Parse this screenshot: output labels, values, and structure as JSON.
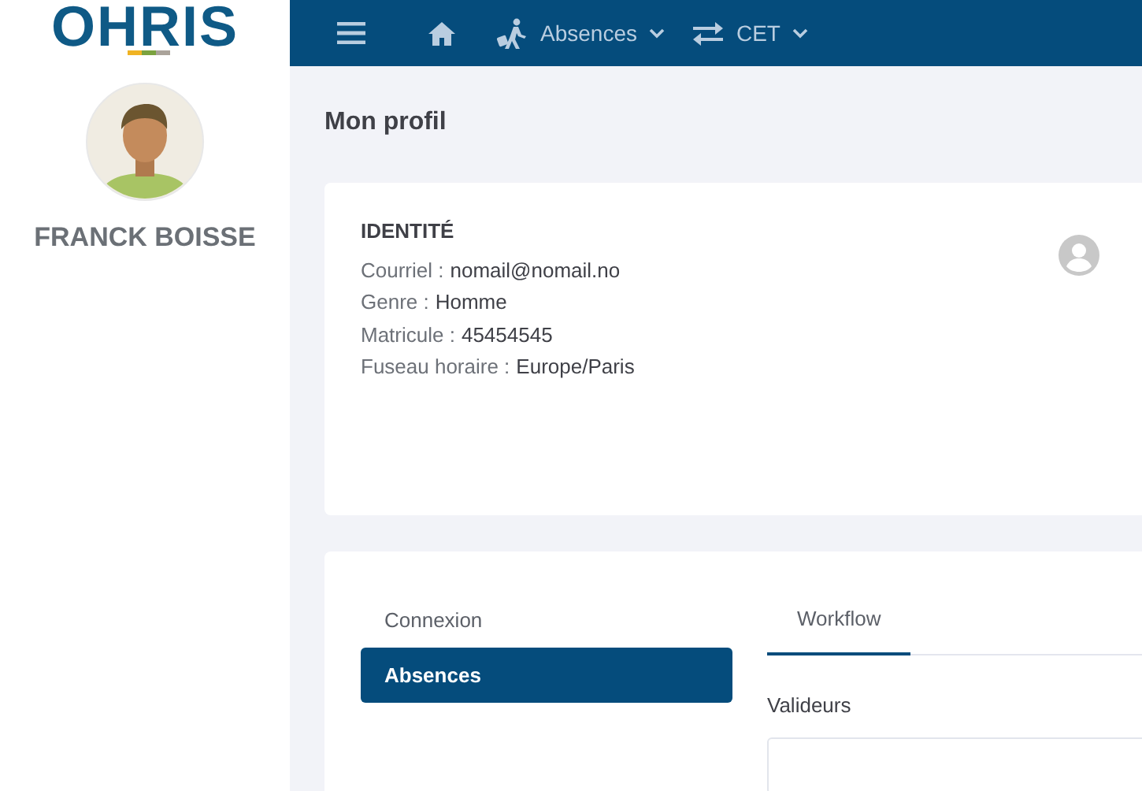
{
  "logo": {
    "text": "OHRIS"
  },
  "user": {
    "name": "FRANCK BOISSE"
  },
  "topbar": {
    "items": [
      {
        "kind": "menu"
      },
      {
        "kind": "home"
      },
      {
        "kind": "dropdown",
        "label": "Absences"
      },
      {
        "kind": "dropdown",
        "label": "CET"
      }
    ]
  },
  "page": {
    "title": "Mon profil"
  },
  "identity": {
    "heading": "IDENTITÉ",
    "fields": [
      {
        "label": "Courriel :",
        "value": "nomail@nomail.no"
      },
      {
        "label": "Genre :",
        "value": "Homme"
      },
      {
        "label": "Matricule :",
        "value": "45454545"
      },
      {
        "label": "Fuseau horaire :",
        "value": "Europe/Paris"
      }
    ]
  },
  "side_menu": [
    {
      "label": "Connexion",
      "selected": false
    },
    {
      "label": "Absences",
      "selected": true
    }
  ],
  "tabs": [
    {
      "label": "Workflow",
      "selected": true
    }
  ],
  "validators": {
    "label": "Valideurs"
  }
}
